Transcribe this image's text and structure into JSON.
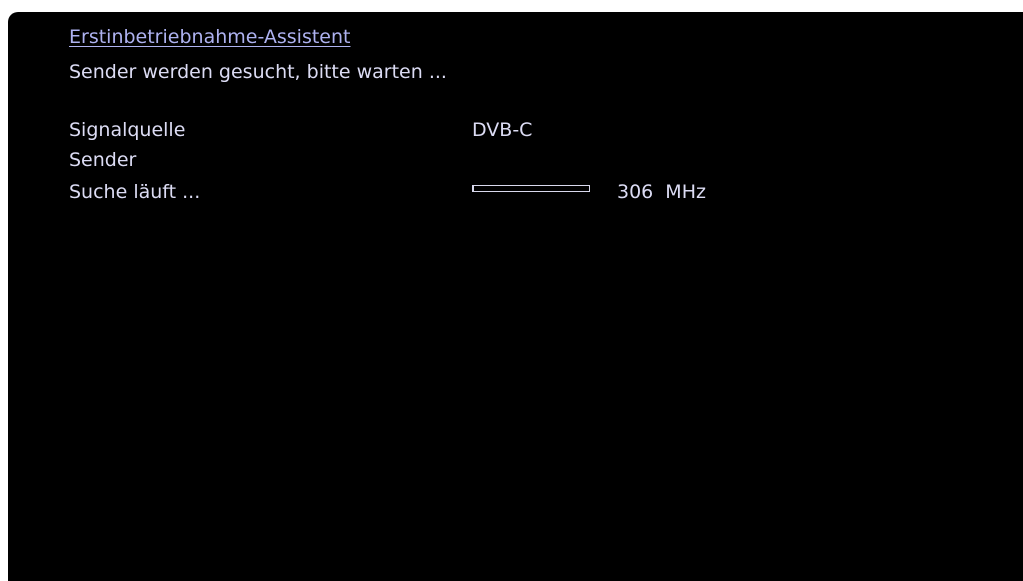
{
  "wizard": {
    "title": "Erstinbetriebnahme-Assistent",
    "status": "Sender werden gesucht, bitte warten ..."
  },
  "fields": {
    "signal_source_label": "Signalquelle",
    "signal_source_value": "DVB-C",
    "stations_label": "Sender",
    "search_label": "Suche läuft ...",
    "search_progress": 0.0,
    "frequency": "306 MHz"
  },
  "colors": {
    "background": "#000000",
    "text": "#dcdcf4",
    "title": "#aeb2f0"
  }
}
